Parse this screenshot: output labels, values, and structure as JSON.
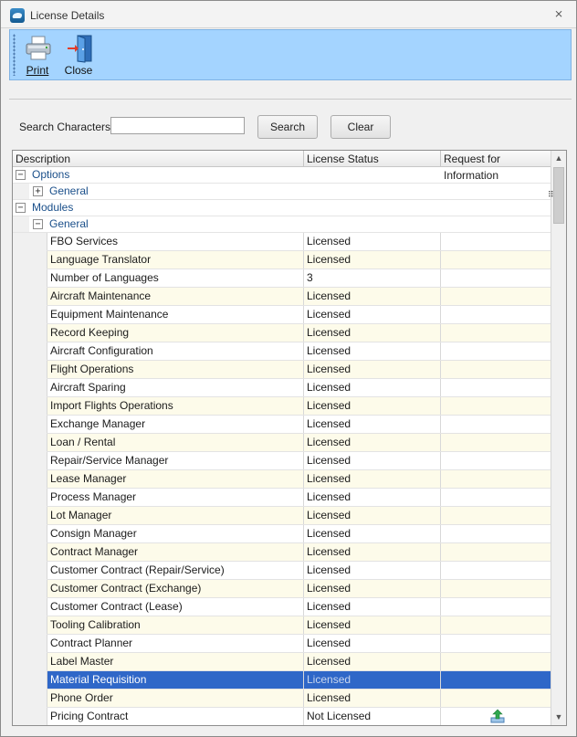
{
  "window": {
    "title": "License Details",
    "close_glyph": "⨯"
  },
  "toolbar": {
    "print_label": "Print",
    "close_label": "Close"
  },
  "search": {
    "label": "Search Characters :",
    "value": "",
    "placeholder": "",
    "search_button": "Search",
    "clear_button": "Clear"
  },
  "grid": {
    "headers": {
      "description": "Description",
      "status": "License Status",
      "rfi": "Request for Information"
    },
    "groups": {
      "options": {
        "label": "Options",
        "expander": "−"
      },
      "options_general": {
        "label": "General",
        "expander": "+"
      },
      "modules": {
        "label": "Modules",
        "expander": "−"
      },
      "modules_general": {
        "label": "General",
        "expander": "−"
      }
    },
    "rows": [
      {
        "description": "FBO Services",
        "status": "Licensed"
      },
      {
        "description": "Language Translator",
        "status": "Licensed"
      },
      {
        "description": "Number of Languages",
        "status": "3"
      },
      {
        "description": "Aircraft Maintenance",
        "status": "Licensed"
      },
      {
        "description": "Equipment Maintenance",
        "status": "Licensed"
      },
      {
        "description": "Record Keeping",
        "status": "Licensed"
      },
      {
        "description": "Aircraft Configuration",
        "status": "Licensed"
      },
      {
        "description": "Flight Operations",
        "status": "Licensed"
      },
      {
        "description": "Aircraft Sparing",
        "status": "Licensed"
      },
      {
        "description": "Import Flights Operations",
        "status": "Licensed"
      },
      {
        "description": "Exchange Manager",
        "status": "Licensed"
      },
      {
        "description": "Loan / Rental",
        "status": "Licensed"
      },
      {
        "description": "Repair/Service Manager",
        "status": "Licensed"
      },
      {
        "description": "Lease Manager",
        "status": "Licensed"
      },
      {
        "description": "Process Manager",
        "status": "Licensed"
      },
      {
        "description": "Lot Manager",
        "status": "Licensed"
      },
      {
        "description": "Consign Manager",
        "status": "Licensed"
      },
      {
        "description": "Contract Manager",
        "status": "Licensed"
      },
      {
        "description": "Customer Contract (Repair/Service)",
        "status": "Licensed"
      },
      {
        "description": "Customer Contract (Exchange)",
        "status": "Licensed"
      },
      {
        "description": "Customer Contract (Lease)",
        "status": "Licensed"
      },
      {
        "description": "Tooling Calibration",
        "status": "Licensed"
      },
      {
        "description": "Contract Planner",
        "status": "Licensed"
      },
      {
        "description": "Label Master",
        "status": "Licensed"
      },
      {
        "description": "Material Requisition",
        "status": "Licensed",
        "selected": true
      },
      {
        "description": "Phone Order",
        "status": "Licensed"
      },
      {
        "description": "Pricing Contract",
        "status": "Not Licensed",
        "rfi_icon": "upload-request-icon"
      }
    ]
  },
  "colors": {
    "toolbar_bg": "#a4d4ff",
    "selection": "#2f67c8",
    "group_text": "#1a4f8a",
    "alt_row": "#fdfbea"
  }
}
